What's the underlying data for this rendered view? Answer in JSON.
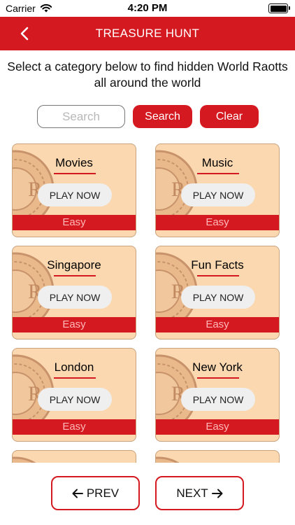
{
  "status_bar": {
    "carrier": "Carrier",
    "time": "4:20 PM"
  },
  "nav": {
    "title": "TREASURE HUNT"
  },
  "intro": {
    "text": "Select a category below to find hidden World Raotts all around the world"
  },
  "search": {
    "placeholder": "Search",
    "value": "",
    "search_label": "Search",
    "clear_label": "Clear"
  },
  "categories": [
    {
      "name": "Movies",
      "play_label": "PLAY NOW",
      "level": "Easy"
    },
    {
      "name": "Music",
      "play_label": "PLAY NOW",
      "level": "Easy"
    },
    {
      "name": "Singapore",
      "play_label": "PLAY NOW",
      "level": "Easy"
    },
    {
      "name": "Fun Facts",
      "play_label": "PLAY NOW",
      "level": "Easy"
    },
    {
      "name": "London",
      "play_label": "PLAY NOW",
      "level": "Easy"
    },
    {
      "name": "New York",
      "play_label": "PLAY NOW",
      "level": "Easy"
    }
  ],
  "pagination": {
    "prev_label": "PREV",
    "next_label": "NEXT"
  },
  "colors": {
    "brand_red": "#d51920",
    "card_bg": "#fbd8b0",
    "button_grey": "#efefef"
  },
  "icons": {
    "back": "chevron-left-icon",
    "prev": "arrow-left-icon",
    "next": "arrow-right-icon",
    "card_art": "coin-icon"
  }
}
